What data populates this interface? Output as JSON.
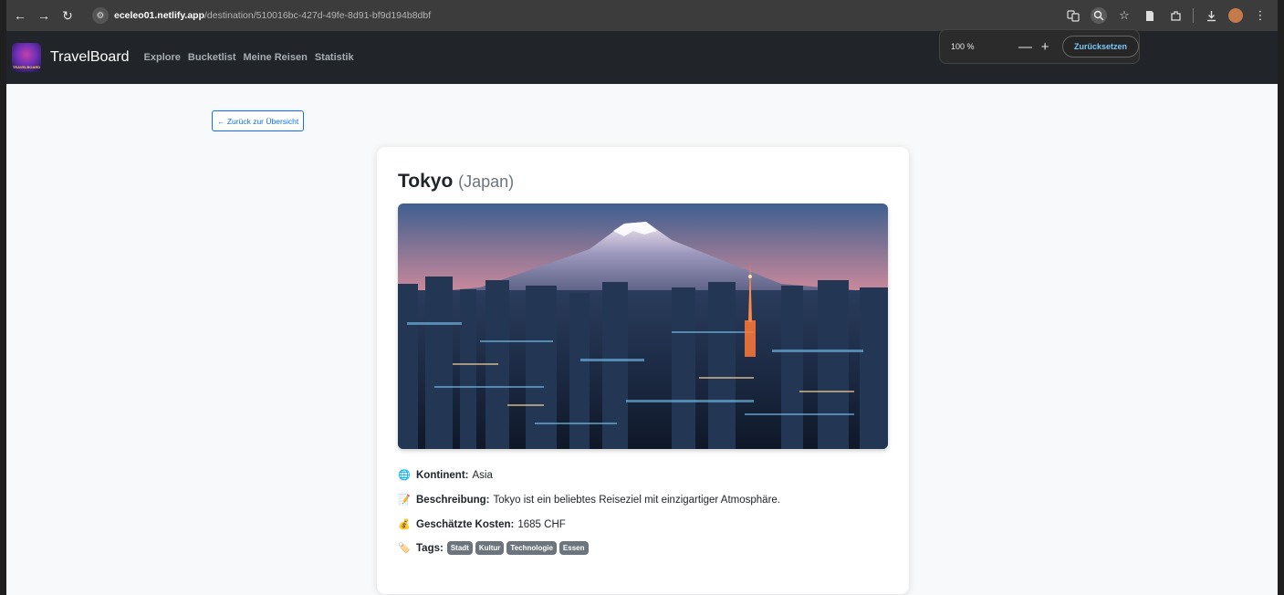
{
  "browser": {
    "back_icon": "←",
    "forward_icon": "→",
    "reload_icon": "↻",
    "site_icon": "⚙",
    "url_host": "eceleo01.netlify.app",
    "url_path": "/destination/510016bc-427d-49fe-8d91-bf9d194b8dbf",
    "zoom_popup": {
      "level": "100 %",
      "minus": "—",
      "plus": "+",
      "reset_label": "Zurücksetzen"
    }
  },
  "navbar": {
    "logo_text": "TRAVELBOARD",
    "brand": "TravelBoard",
    "links": [
      "Explore",
      "Bucketlist",
      "Meine Reisen",
      "Statistik"
    ]
  },
  "page": {
    "back_label": "← Zurück zur Übersicht",
    "city": "Tokyo",
    "country": "(Japan)",
    "continent_label": "Kontinent:",
    "continent_value": "Asia",
    "description_label": "Beschreibung:",
    "description_value": "Tokyo ist ein beliebtes Reiseziel mit einzigartiger Atmosphäre.",
    "cost_label": "Geschätzte Kosten:",
    "cost_value": "1685 CHF",
    "tags_label": "Tags:",
    "tags": [
      "Stadt",
      "Kultur",
      "Technologie",
      "Essen"
    ],
    "icons": {
      "continent": "🌐",
      "description": "📝",
      "cost": "💰",
      "tags": "🏷️"
    }
  },
  "colors": {
    "navbar_bg": "#212529",
    "primary": "#0d6efd",
    "tag_bg": "#6c757d"
  }
}
